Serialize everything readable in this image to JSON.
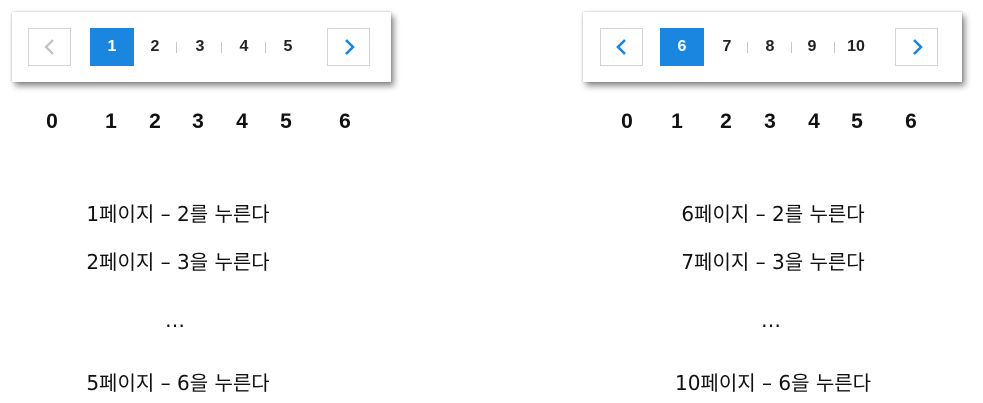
{
  "left": {
    "prev_icon": "chevron-left-icon",
    "prev_state": "disabled",
    "next_icon": "chevron-right-icon",
    "pages": [
      "1",
      "2",
      "3",
      "4",
      "5"
    ],
    "active_page": "1",
    "indices": [
      "0",
      "1",
      "2",
      "3",
      "4",
      "5",
      "6"
    ],
    "steps": [
      "1페이지 – 2를 누른다",
      "2페이지 – 3을 누른다",
      "…",
      "5페이지 – 6을 누른다"
    ]
  },
  "right": {
    "prev_icon": "chevron-left-icon",
    "prev_state": "enabled",
    "next_icon": "chevron-right-icon",
    "pages": [
      "6",
      "7",
      "8",
      "9",
      "10"
    ],
    "active_page": "6",
    "indices": [
      "0",
      "1",
      "2",
      "3",
      "4",
      "5",
      "6"
    ],
    "steps": [
      "6페이지 – 2를 누른다",
      "7페이지 – 3을 누른다",
      "…",
      "10페이지 – 6을 누른다"
    ]
  },
  "colors": {
    "active_bg": "#1a86e0",
    "arrow_enabled": "#1a86e0",
    "arrow_disabled": "#c0c0c0"
  }
}
